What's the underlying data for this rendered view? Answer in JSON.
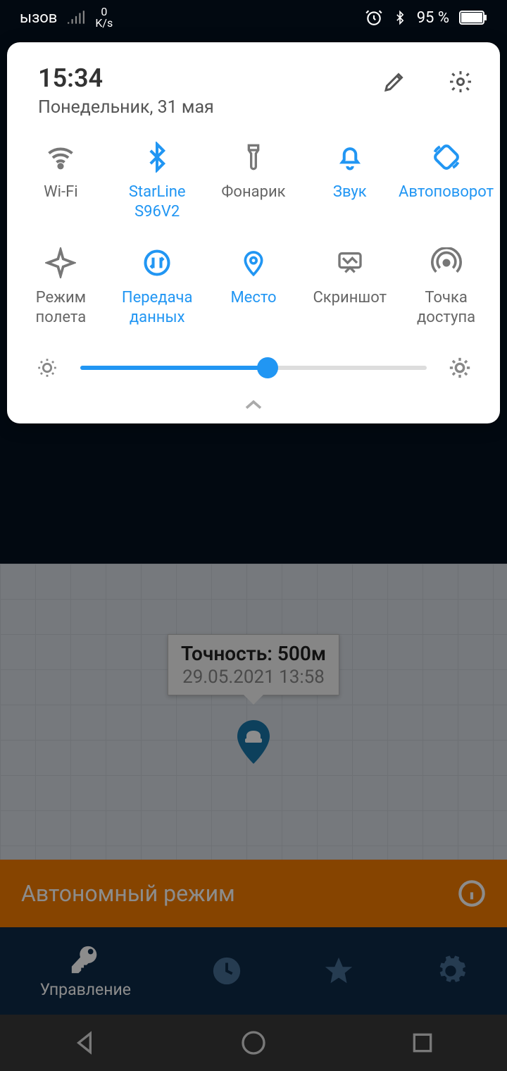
{
  "statusbar": {
    "left_text": "ызов",
    "net_top": "0",
    "net_bottom": "K/s",
    "battery_pct": "95 %"
  },
  "qs": {
    "time": "15:34",
    "date": "Понедельник, 31 мая",
    "tiles": [
      {
        "id": "wifi",
        "label": "Wi-Fi",
        "active": false
      },
      {
        "id": "bluetooth",
        "label": "StarLine S96V2",
        "active": true
      },
      {
        "id": "flashlight",
        "label": "Фонарик",
        "active": false
      },
      {
        "id": "sound",
        "label": "Звук",
        "active": true
      },
      {
        "id": "autorotate",
        "label": "Автоповорот",
        "active": true
      },
      {
        "id": "airplane",
        "label": "Режим полета",
        "active": false
      },
      {
        "id": "mobiledata",
        "label": "Передача данных",
        "active": true
      },
      {
        "id": "location",
        "label": "Место",
        "active": true
      },
      {
        "id": "screenshot",
        "label": "Скриншот",
        "active": false
      },
      {
        "id": "hotspot",
        "label": "Точка доступа",
        "active": false
      }
    ],
    "brightness_pct": 54
  },
  "map": {
    "callout_title": "Точность: 500м",
    "callout_time": "29.05.2021 13:58"
  },
  "mode_bar": {
    "text": "Автономный режим"
  },
  "bottom_nav": {
    "items": [
      {
        "id": "control",
        "label": "Управление",
        "active": true
      },
      {
        "id": "history",
        "label": "",
        "active": false
      },
      {
        "id": "favorites",
        "label": "",
        "active": false
      },
      {
        "id": "settings",
        "label": "",
        "active": false
      }
    ]
  }
}
